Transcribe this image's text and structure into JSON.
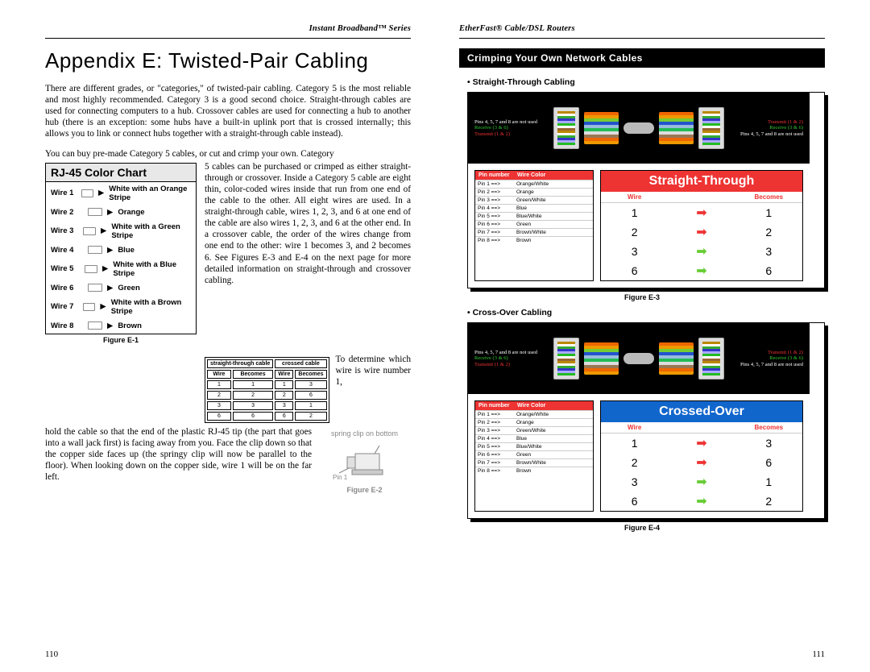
{
  "left": {
    "header": "Instant Broadband™ Series",
    "title": "Appendix E: Twisted-Pair Cabling",
    "para1": "There are different grades, or \"categories,\" of twisted-pair cabling. Category 5 is the most reliable and most highly recommended. Category 3 is a good second choice. Straight-through cables are used for connecting computers to a hub. Crossover cables are used for connecting a hub to another hub (there is an exception: some hubs have a built-in uplink port that is crossed internally; this allows you to link or connect hubs together with a straight-through cable instead).",
    "para2_intro": "You can buy pre-made Category 5 cables, or cut and crimp your own. Category",
    "para2_wrap": "5 cables can be purchased or crimped as either straight-through or crossover. Inside a Category 5 cable are eight thin, color-coded wires inside that run from one end of the cable to the other. All eight wires are used. In a straight-through cable, wires 1, 2, 3, and 6 at one end of the cable are also wires 1, 2, 3, and 6 at the other end. In a crossover cable, the order of the wires change from one end to the other: wire 1 becomes 3, and 2 becomes 6. See Figures E-3 and E-4 on the next page for more detailed information on straight-through and crossover cabling.",
    "para3_intro": "To determine which wire is wire number 1,",
    "para3_rest": "hold the cable so that the end of the plastic RJ-45 tip (the part that goes into a wall jack first) is facing away from you. Face the clip down so that the copper side faces up (the springy clip will now be parallel to the floor). When looking down on the copper side, wire 1 will be on the far left.",
    "rj45": {
      "title": "RJ-45 Color Chart",
      "wires": [
        {
          "name": "Wire 1",
          "color": "White with an Orange Stripe"
        },
        {
          "name": "Wire 2",
          "color": "Orange"
        },
        {
          "name": "Wire 3",
          "color": "White with a Green Stripe"
        },
        {
          "name": "Wire 4",
          "color": "Blue"
        },
        {
          "name": "Wire 5",
          "color": "White with a Blue Stripe"
        },
        {
          "name": "Wire 6",
          "color": "Green"
        },
        {
          "name": "Wire 7",
          "color": "White with a Brown Stripe"
        },
        {
          "name": "Wire 8",
          "color": "Brown"
        }
      ]
    },
    "fig_e1": "Figure E-1",
    "fig_e2": "Figure E-2",
    "mini_headers": {
      "st": "straight-through cable",
      "co": "crossed cable",
      "wire": "Wire",
      "becomes": "Becomes"
    },
    "mini_st": [
      [
        1,
        1
      ],
      [
        2,
        2
      ],
      [
        3,
        3
      ],
      [
        6,
        6
      ]
    ],
    "mini_co": [
      [
        1,
        3
      ],
      [
        2,
        6
      ],
      [
        3,
        1
      ],
      [
        6,
        2
      ]
    ],
    "tip": {
      "spring": "spring clip on bottom",
      "pin1": "Pin 1"
    },
    "page": "110"
  },
  "right": {
    "header": "EtherFast® Cable/DSL Routers",
    "section": "Crimping Your Own Network Cables",
    "st_label": "•  Straight-Through Cabling",
    "co_label": "•  Cross-Over Cabling",
    "fig_e3": "Figure E-3",
    "fig_e4": "Figure E-4",
    "pins_unused": "Pins 4, 5, 7 and 8 are not used",
    "lbl_receive": "Receive (3 & 6)",
    "lbl_transmit": "Transmit (1 & 2)",
    "pinmap_hdr": {
      "pin": "Pin number",
      "color": "Wire Color"
    },
    "pinmap": [
      {
        "pin": "Pin 1 ==>",
        "color": "Orange/White"
      },
      {
        "pin": "Pin 2 ==>",
        "color": "Orange"
      },
      {
        "pin": "Pin 3 ==>",
        "color": "Green/White"
      },
      {
        "pin": "Pin 4 ==>",
        "color": "Blue"
      },
      {
        "pin": "Pin 5 ==>",
        "color": "Blue/White"
      },
      {
        "pin": "Pin 6 ==>",
        "color": "Green"
      },
      {
        "pin": "Pin 7 ==>",
        "color": "Brown/White"
      },
      {
        "pin": "Pin 8 ==>",
        "color": "Brown"
      }
    ],
    "becomes_hdr": {
      "wire": "Wire",
      "becomes": "Becomes"
    },
    "st_badge": "Straight-Through",
    "co_badge": "Crossed-Over",
    "st_map": [
      {
        "w": 1,
        "b": 1,
        "c": "red"
      },
      {
        "w": 2,
        "b": 2,
        "c": "red"
      },
      {
        "w": 3,
        "b": 3,
        "c": "green"
      },
      {
        "w": 6,
        "b": 6,
        "c": "green"
      }
    ],
    "co_map": [
      {
        "w": 1,
        "b": 3,
        "c": "red"
      },
      {
        "w": 2,
        "b": 6,
        "c": "red"
      },
      {
        "w": 3,
        "b": 1,
        "c": "green"
      },
      {
        "w": 6,
        "b": 2,
        "c": "green"
      }
    ],
    "page": "111"
  },
  "chart_data": {
    "type": "table",
    "title": "Wire → Becomes mapping",
    "series": [
      {
        "name": "Straight-Through",
        "wire": [
          1,
          2,
          3,
          6
        ],
        "becomes": [
          1,
          2,
          3,
          6
        ]
      },
      {
        "name": "Crossed-Over",
        "wire": [
          1,
          2,
          3,
          6
        ],
        "becomes": [
          3,
          6,
          1,
          2
        ]
      }
    ],
    "rj45_colors": [
      {
        "wire": 1,
        "color": "White / Orange Stripe"
      },
      {
        "wire": 2,
        "color": "Orange"
      },
      {
        "wire": 3,
        "color": "White / Green Stripe"
      },
      {
        "wire": 4,
        "color": "Blue"
      },
      {
        "wire": 5,
        "color": "White / Blue Stripe"
      },
      {
        "wire": 6,
        "color": "Green"
      },
      {
        "wire": 7,
        "color": "White / Brown Stripe"
      },
      {
        "wire": 8,
        "color": "Brown"
      }
    ]
  }
}
